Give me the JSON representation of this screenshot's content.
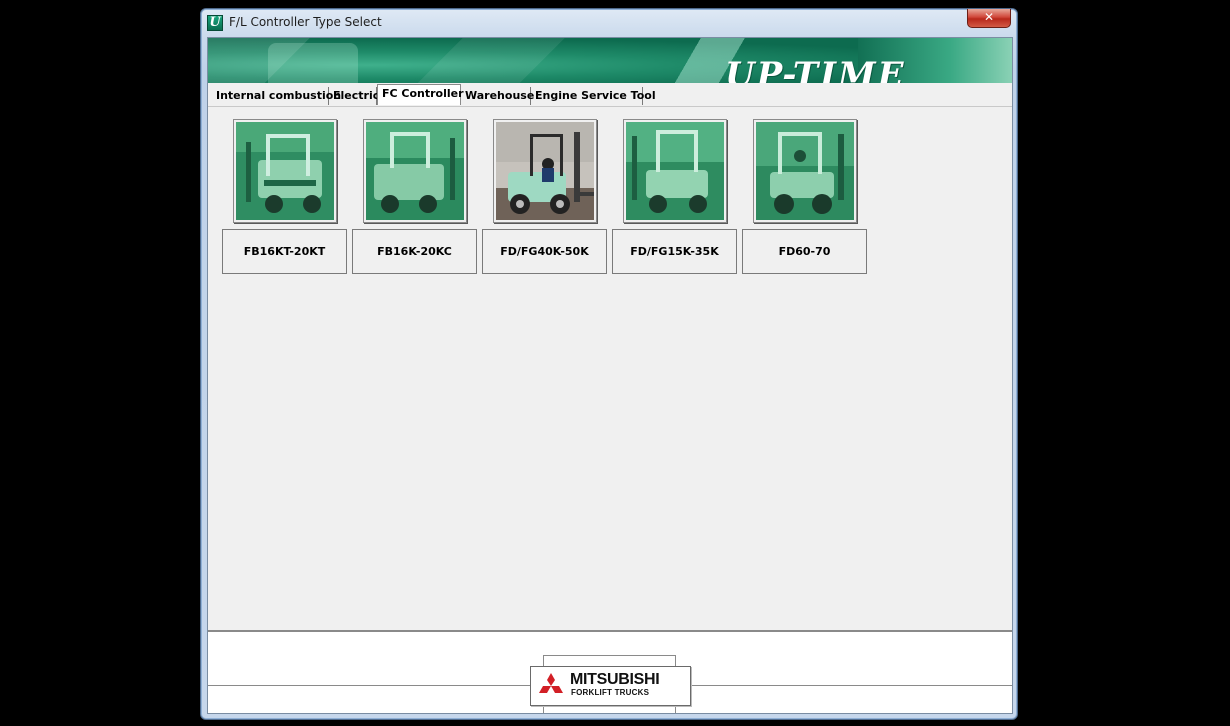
{
  "window": {
    "title": "F/L Controller Type Select",
    "app_icon": "U"
  },
  "titlebar": {
    "close_glyph": "✕"
  },
  "banner": {
    "logo_text": "UP-TIME"
  },
  "tabs": [
    {
      "label": "Internal combustion",
      "active": false
    },
    {
      "label": "Electric",
      "active": false
    },
    {
      "label": "FC Controller",
      "active": true
    },
    {
      "label": "Warehouse",
      "active": false
    },
    {
      "label": "Engine Service Tool",
      "active": false
    }
  ],
  "models": [
    {
      "label": "FB16KT-20KT",
      "image": "electric-forklift-photo",
      "enabled": false
    },
    {
      "label": "FB16K-20KC",
      "image": "electric-forklift-photo",
      "enabled": false
    },
    {
      "label": "FD/FG40K-50K",
      "image": "diesel-forklift-photo",
      "enabled": true
    },
    {
      "label": "FD/FG15K-35K",
      "image": "forklift-photo",
      "enabled": false
    },
    {
      "label": "FD60-70",
      "image": "large-forklift-photo",
      "enabled": false
    }
  ],
  "footer": {
    "brand_line1": "MITSUBISHI",
    "brand_line2": "FORKLIFT TRUCKS",
    "brand_color": "#d21f26"
  }
}
